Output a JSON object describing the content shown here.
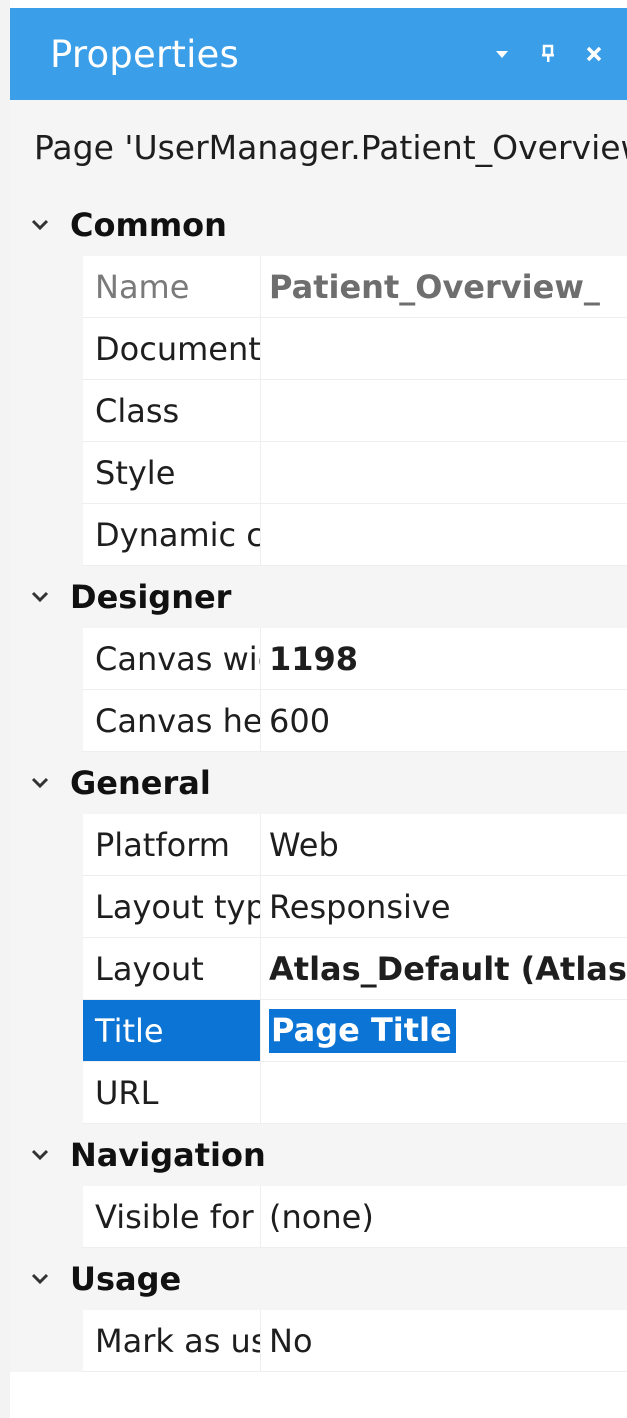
{
  "panel": {
    "title": "Properties",
    "title_bg": "#3b9ee8",
    "buttons": [
      "dropdown-icon",
      "pin-icon",
      "close-icon"
    ]
  },
  "object": {
    "label": "Page 'UserManager.Patient_Overview'"
  },
  "colors": {
    "selection": "#0b74d4",
    "category_bg": "#f5f5f5"
  },
  "categories": [
    {
      "label": "Common",
      "props": [
        {
          "name": "Name",
          "value": "Patient_Overview_",
          "state": "disabled-bold"
        },
        {
          "name": "Documentation",
          "value": ""
        },
        {
          "name": "Class",
          "value": ""
        },
        {
          "name": "Style",
          "value": ""
        },
        {
          "name": "Dynamic classes",
          "value": ""
        }
      ]
    },
    {
      "label": "Designer",
      "props": [
        {
          "name": "Canvas width",
          "value": "1198",
          "state": "bold"
        },
        {
          "name": "Canvas height",
          "value": "600"
        }
      ]
    },
    {
      "label": "General",
      "props": [
        {
          "name": "Platform",
          "value": "Web"
        },
        {
          "name": "Layout type",
          "value": "Responsive"
        },
        {
          "name": "Layout",
          "value": "Atlas_Default (Atlas_Core)",
          "state": "bold"
        },
        {
          "name": "Title",
          "value": "Page Title",
          "state": "selected"
        },
        {
          "name": "URL",
          "value": ""
        }
      ]
    },
    {
      "label": "Navigation",
      "props": [
        {
          "name": "Visible for",
          "value": "(none)"
        }
      ]
    },
    {
      "label": "Usage",
      "props": [
        {
          "name": "Mark as used",
          "value": "No"
        }
      ]
    }
  ]
}
